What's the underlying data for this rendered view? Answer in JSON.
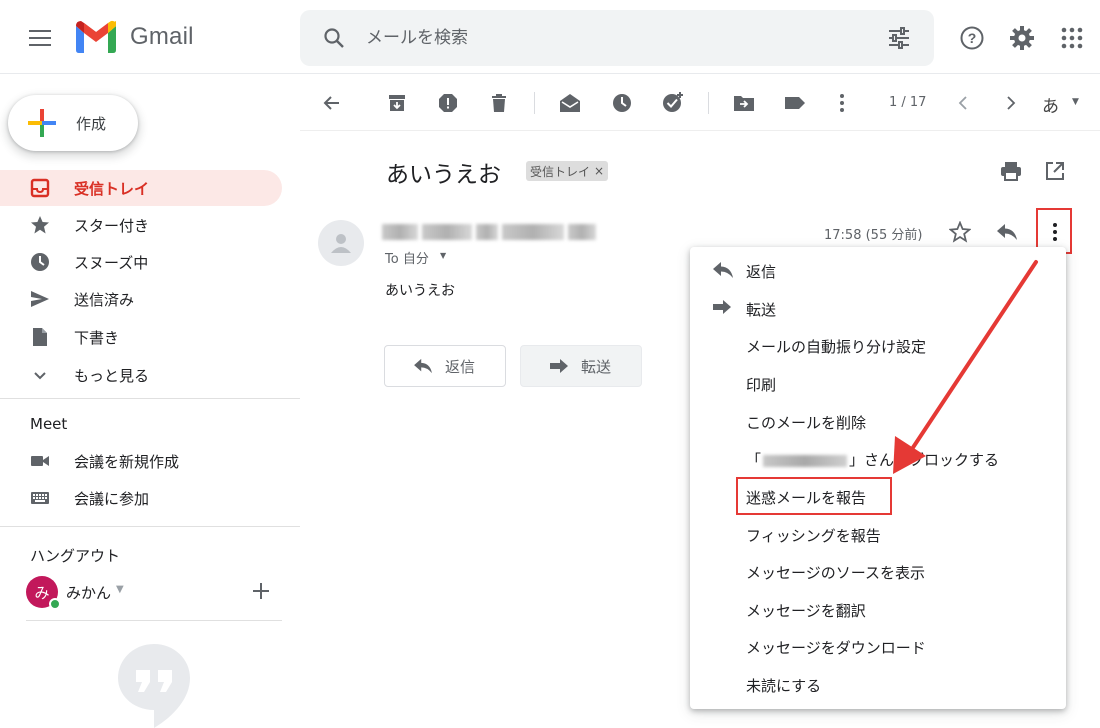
{
  "app": {
    "name": "Gmail"
  },
  "search": {
    "placeholder": "メールを検索"
  },
  "compose": {
    "label": "作成"
  },
  "sidebar": {
    "items": [
      {
        "label": "受信トレイ",
        "icon": "inbox-icon",
        "active": true
      },
      {
        "label": "スター付き",
        "icon": "star-icon"
      },
      {
        "label": "スヌーズ中",
        "icon": "clock-icon"
      },
      {
        "label": "送信済み",
        "icon": "send-icon"
      },
      {
        "label": "下書き",
        "icon": "draft-icon"
      },
      {
        "label": "もっと見る",
        "icon": "chevron-down-icon"
      }
    ],
    "meet": {
      "title": "Meet",
      "items": [
        {
          "label": "会議を新規作成",
          "icon": "video-icon"
        },
        {
          "label": "会議に参加",
          "icon": "keyboard-icon"
        }
      ]
    },
    "hangouts": {
      "title": "ハングアウト",
      "user": "みかん",
      "avatar_letter": "み"
    }
  },
  "toolbar": {
    "pager": "1 / 17",
    "input_language": "あ"
  },
  "message": {
    "subject": "あいうえお",
    "label_chip": "受信トレイ",
    "label_chip_close": "×",
    "to": "To 自分",
    "time": "17:58 (55 分前)",
    "body": "あいうえお",
    "reply_label": "返信",
    "forward_label": "転送"
  },
  "dropdown": {
    "items": [
      {
        "label": "返信",
        "icon": "reply-icon"
      },
      {
        "label": "転送",
        "icon": "forward-icon"
      },
      {
        "label": "メールの自動振り分け設定"
      },
      {
        "label": "印刷"
      },
      {
        "label": "このメールを削除"
      },
      {
        "label_prefix": "「",
        "label_suffix": "」さんをブロックする"
      },
      {
        "label": "迷惑メールを報告",
        "highlighted": true
      },
      {
        "label": "フィッシングを報告"
      },
      {
        "label": "メッセージのソースを表示"
      },
      {
        "label": "メッセージを翻訳"
      },
      {
        "label": "メッセージをダウンロード"
      },
      {
        "label": "未読にする"
      }
    ]
  },
  "colors": {
    "accent_red": "#d93025",
    "highlight_red": "#e53935",
    "active_bg": "#fce8e6"
  }
}
